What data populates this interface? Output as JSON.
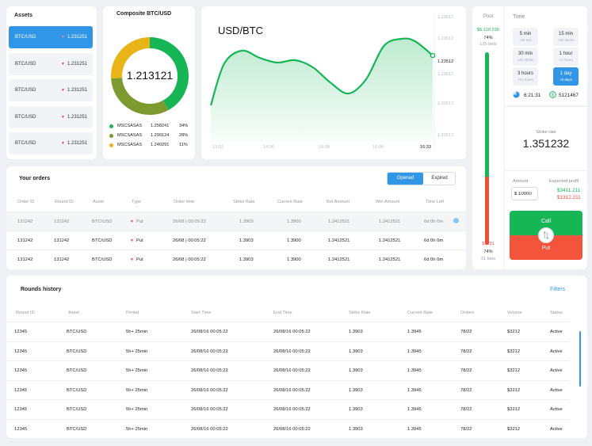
{
  "assets": {
    "title": "Assets",
    "items": [
      {
        "name": "BTC/USD",
        "value": "1.231251"
      },
      {
        "name": "BTC/USD",
        "value": "1.231251"
      },
      {
        "name": "BTC/USD",
        "value": "1.231251"
      },
      {
        "name": "BTC/USD",
        "value": "1.231251"
      },
      {
        "name": "BTC/USD",
        "value": "1.231251"
      }
    ],
    "down_color": "#e8453c",
    "active_color": "#3296e6"
  },
  "composite": {
    "title": "Composite BTC/USD",
    "center_value": "1.213121",
    "legend": [
      {
        "name": "MSCSASAS",
        "value": "1.258241",
        "percent": "34%",
        "color": "#16b556"
      },
      {
        "name": "MSCSASAS",
        "value": "1.299124",
        "percent": "28%",
        "color": "#7d9a2e"
      },
      {
        "name": "MSCSASAS",
        "value": "1.240291",
        "percent": "11%",
        "color": "#e8b417"
      }
    ],
    "ring": [
      {
        "share": 0.42,
        "color": "#16b556"
      },
      {
        "share": 0.32,
        "color": "#7d9a2e"
      },
      {
        "share": 0.26,
        "color": "#e8b417"
      }
    ]
  },
  "chart_data": {
    "type": "area",
    "title": "USD/BTC",
    "x_ticks": [
      "13:02",
      "14:00",
      "15:00",
      "16:00",
      "16:33"
    ],
    "y_ticks": [
      "1.23512",
      "1.23512",
      "1.23512",
      "1.23512",
      "1.23512",
      "1.23512"
    ],
    "current_value": "1.23512",
    "x": [
      0,
      0.06,
      0.14,
      0.22,
      0.3,
      0.38,
      0.46,
      0.54,
      0.62,
      0.7,
      0.78,
      0.86,
      0.92,
      1.0
    ],
    "y": [
      1.229,
      1.2325,
      1.2336,
      1.233,
      1.2326,
      1.2328,
      1.2322,
      1.2309,
      1.23,
      1.2312,
      1.234,
      1.2346,
      1.2344,
      1.2332
    ],
    "ylim": [
      1.226,
      1.236
    ],
    "line_color": "#16b556",
    "grid": false
  },
  "pool": {
    "title": "Pool",
    "top_amount": "$5,120,236",
    "top_percent": "74%",
    "top_bets": "135 bets",
    "bottom_amount": "$1231",
    "bottom_percent": "74%",
    "bottom_bets": "31 bets",
    "green_share": 0.646
  },
  "time": {
    "title": "Time",
    "options": [
      {
        "label": "5 min",
        "sub": "+25 min",
        "selected": false
      },
      {
        "label": "15 min",
        "sub": "+30-45min",
        "selected": false
      },
      {
        "label": "30 min",
        "sub": "+30-30min",
        "selected": false
      },
      {
        "label": "1 hour",
        "sub": "+1 hours",
        "selected": false
      },
      {
        "label": "3 hours",
        "sub": "+21 hours",
        "selected": false
      },
      {
        "label": "1 day",
        "sub": "+5 days",
        "selected": true
      }
    ],
    "timer": "6:21:31",
    "balance": "5121467"
  },
  "strike": {
    "label": "Strike rate",
    "value": "1.351232",
    "amount_label": "Amount",
    "amount_value": "$ 10000",
    "profit_label": "Expected profit",
    "profit_up": "$3411.211",
    "profit_down": "$1312.211",
    "call_label": "Call",
    "put_label": "Put"
  },
  "orders": {
    "title": "Your orders",
    "tabs": [
      "Opened",
      "Expired"
    ],
    "columns": [
      "Order ID",
      "Round ID",
      "Asset",
      "Type",
      "Order time",
      "Strike Rate",
      "Current Rate",
      "Bet Amount",
      "Win Amount",
      "Time Left"
    ],
    "rows": [
      [
        "131242",
        "131242",
        "BTC/USD",
        "Put",
        "26/08 | 00:05:22",
        "1.3903",
        "1.3900",
        "1.2412521",
        "1.2412521",
        "6d 0h 0m"
      ],
      [
        "131242",
        "131242",
        "BTC/USD",
        "Put",
        "26/08 | 00:05:22",
        "1.3903",
        "1.3900",
        "1.2412521",
        "1.2412521",
        "6d 0h 0m"
      ],
      [
        "131242",
        "131242",
        "BTC/USD",
        "Put",
        "26/08 | 00:05:22",
        "1.3903",
        "1.3900",
        "1.2412521",
        "1.2412521",
        "6d 0h 0m"
      ]
    ]
  },
  "rounds": {
    "title": "Rounds history",
    "filters_label": "Filters",
    "columns": [
      "Round ID",
      "Asset",
      "Period",
      "Start Time",
      "End Time",
      "Strike Rate",
      "Current Rate",
      "Orders",
      "Volume",
      "Status"
    ],
    "rows": [
      [
        "12345",
        "BTC/USD",
        "5h+ 25min",
        "26/08/16 00:05:22",
        "26/08/16 00:05:22",
        "1.3903",
        "1.3945",
        "78/22",
        "$3212",
        "Active"
      ],
      [
        "12345",
        "BTC/USD",
        "5h+ 25min",
        "26/08/16 00:05:22",
        "26/08/16 00:05:22",
        "1.3903",
        "1.3945",
        "78/22",
        "$3212",
        "Active"
      ],
      [
        "12345",
        "BTC/USD",
        "5h+ 25min",
        "26/08/16 00:05:22",
        "26/08/16 00:05:22",
        "1.3903",
        "1.3945",
        "78/22",
        "$3212",
        "Active"
      ],
      [
        "12345",
        "BTC/USD",
        "5h+ 25min",
        "26/08/16 00:05:22",
        "26/08/16 00:05:22",
        "1.3903",
        "1.3945",
        "78/22",
        "$3212",
        "Active"
      ],
      [
        "12345",
        "BTC/USD",
        "5h+ 25min",
        "26/08/16 00:05:22",
        "26/08/16 00:05:22",
        "1.3903",
        "1.3945",
        "78/22",
        "$3212",
        "Active"
      ],
      [
        "12345",
        "BTC/USD",
        "5h+ 25min",
        "26/08/16 00:05:22",
        "26/08/16 00:05:22",
        "1.3903",
        "1.3945",
        "78/22",
        "$3212",
        "Active"
      ]
    ]
  }
}
